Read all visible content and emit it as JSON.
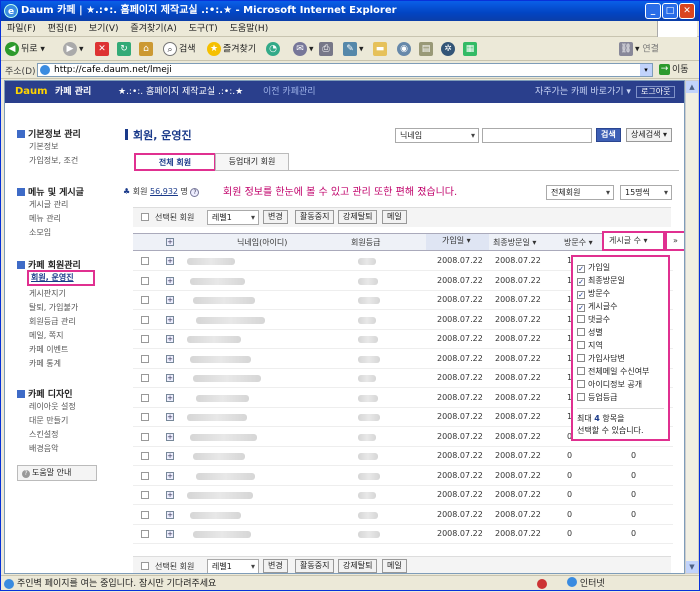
{
  "window": {
    "title": "Daum 카페 | ★.:•:. 홈페이지 제작교실 .:•:.★ - Microsoft Internet Explorer"
  },
  "menu": [
    "파일(F)",
    "편집(E)",
    "보기(V)",
    "즐겨찾기(A)",
    "도구(T)",
    "도움말(H)"
  ],
  "toolbar": {
    "back": "뒤로",
    "search": "검색",
    "favorites": "즐겨찾기",
    "links": "연결"
  },
  "address": {
    "label": "주소(D)",
    "url": "http://cafe.daum.net/lmeji",
    "go": "이동"
  },
  "cafe": {
    "logo": "Daum",
    "manage": "카페 관리",
    "name": "★.:•:. 홈페이지 제작교실 .:•:.★",
    "prev": "이전 카페관리",
    "frequent": "자주가는 카페 바로가기",
    "logout": "로그아웃"
  },
  "sidebar": {
    "groups": [
      {
        "title": "기본정보 관리",
        "items": [
          "기본정보",
          "가입정보, 조건"
        ]
      },
      {
        "title": "메뉴 및 게시글",
        "items": [
          "게시글 관리",
          "메뉴 관리",
          "소모임"
        ]
      },
      {
        "title": "카페 회원관리",
        "items": [
          "회원, 운영진",
          "게시판지기",
          "탈퇴, 가입불가",
          "회원등급 관리",
          "메일, 쪽지",
          "카페 이벤트",
          "카페 통계"
        ]
      },
      {
        "title": "카페 디자인",
        "items": [
          "레이아웃 설정",
          "대문 만들기",
          "스킨설정",
          "배경음악"
        ]
      }
    ],
    "help": "도움말 안내"
  },
  "main": {
    "title": "회원, 운영진",
    "search_select": "닉네임",
    "search_btn": "검색",
    "adv_search": "상세검색",
    "tabs": [
      "전체 회원",
      "등업대기 회원"
    ],
    "member_label": "회원",
    "member_count": "56,932",
    "member_unit": "명",
    "notice": "회원 정보를  한눈에 볼 수 있고 관리 또한 편해 졌습니다.",
    "filter_select": "전체회원",
    "perpage_select": "15명씩",
    "selected_label": "선택된 회원",
    "level_select": "레벨1",
    "change": "변경",
    "suspend": "활동중지",
    "ban": "강제탈퇴",
    "mail": "메일",
    "columns": [
      "닉네임(아이디)",
      "회원등급",
      "가입일",
      "최종방문일",
      "방문수",
      "게시글 수"
    ],
    "rows": [
      {
        "joined": "2008.07.22",
        "last": "2008.07.22",
        "visits": "1"
      },
      {
        "joined": "2008.07.22",
        "last": "2008.07.22",
        "visits": "1"
      },
      {
        "joined": "2008.07.22",
        "last": "2008.07.22",
        "visits": "1"
      },
      {
        "joined": "2008.07.22",
        "last": "2008.07.22",
        "visits": "1"
      },
      {
        "joined": "2008.07.22",
        "last": "2008.07.22",
        "visits": "1"
      },
      {
        "joined": "2008.07.22",
        "last": "2008.07.22",
        "visits": "1"
      },
      {
        "joined": "2008.07.22",
        "last": "2008.07.22",
        "visits": "1"
      },
      {
        "joined": "2008.07.22",
        "last": "2008.07.22",
        "visits": "1"
      },
      {
        "joined": "2008.07.22",
        "last": "2008.07.22",
        "visits": "1"
      },
      {
        "joined": "2008.07.22",
        "last": "2008.07.22",
        "visits": "0",
        "posts": "0"
      },
      {
        "joined": "2008.07.22",
        "last": "2008.07.22",
        "visits": "0",
        "posts": "0"
      },
      {
        "joined": "2008.07.22",
        "last": "2008.07.22",
        "visits": "0",
        "posts": "0"
      },
      {
        "joined": "2008.07.22",
        "last": "2008.07.22",
        "visits": "0",
        "posts": "0"
      },
      {
        "joined": "2008.07.22",
        "last": "2008.07.22",
        "visits": "0",
        "posts": "0"
      },
      {
        "joined": "2008.07.22",
        "last": "2008.07.22",
        "visits": "0",
        "posts": "0"
      }
    ],
    "popup": {
      "options": [
        {
          "label": "가입일",
          "checked": true
        },
        {
          "label": "최종방문일",
          "checked": true
        },
        {
          "label": "방문수",
          "checked": true
        },
        {
          "label": "게시글수",
          "checked": true
        },
        {
          "label": "댓글수",
          "checked": false
        },
        {
          "label": "성별",
          "checked": false
        },
        {
          "label": "지역",
          "checked": false
        },
        {
          "label": "가입사담변",
          "checked": false
        },
        {
          "label": "전체메일 수신여부",
          "checked": false
        },
        {
          "label": "아이디정보 공개",
          "checked": false
        },
        {
          "label": "등업등급",
          "checked": false
        }
      ],
      "note1": "최대",
      "note_num": "4",
      "note2": "항목을",
      "note3": "선택할 수 있습니다."
    }
  },
  "status": {
    "text": "주인벽 페이지를 여는 중입니다. 잠시만 기다려주세요",
    "zone": "인터넷"
  }
}
